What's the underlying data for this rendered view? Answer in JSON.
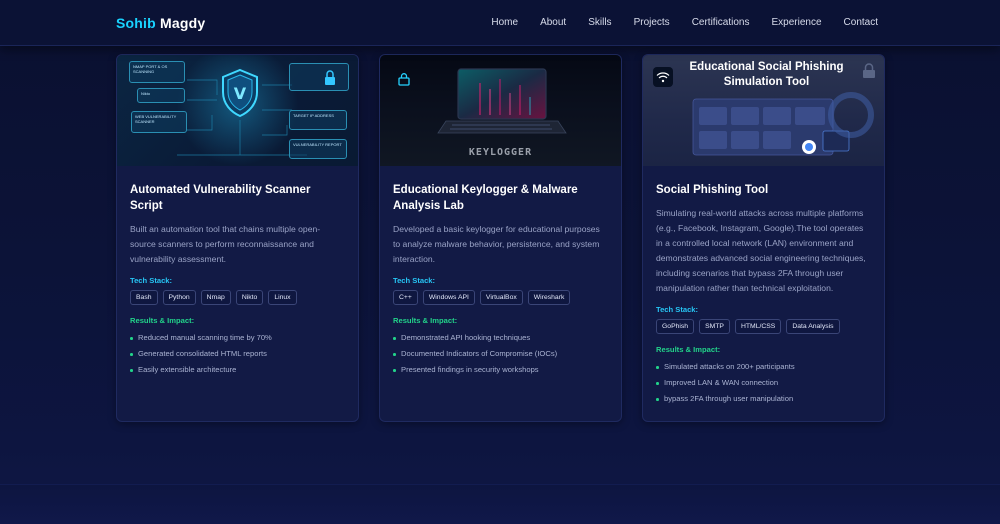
{
  "brand": {
    "first": "Sohib",
    "last": "Magdy"
  },
  "nav": [
    "Home",
    "About",
    "Skills",
    "Projects",
    "Certifications",
    "Experience",
    "Contact"
  ],
  "tech_stack_label": "Tech Stack:",
  "results_label": "Results & Impact:",
  "projects": [
    {
      "title": "Automated Vulnerability Scanner Script",
      "description": "Built an automation tool that chains multiple open-source scanners to perform reconnaissance and vulnerability assessment.",
      "tech": [
        "Bash",
        "Python",
        "Nmap",
        "Nikto",
        "Linux"
      ],
      "impact": [
        "Reduced manual scanning time by 70%",
        "Generated consolidated HTML reports",
        "Easily extensible architecture"
      ],
      "image": {
        "panels": [
          "NMAP PORT & OS SCANNING",
          "Nikto",
          "WEB VULNERABILITY SCANNER",
          "TARGET IP ADDRESS",
          "VULNERABILITY REPORT"
        ],
        "shield_letter": "V"
      }
    },
    {
      "title": "Educational Keylogger & Malware Analysis Lab",
      "description": "Developed a basic keylogger for educational purposes to analyze malware behavior, persistence, and system interaction.",
      "tech": [
        "C++",
        "Windows API",
        "VirtualBox",
        "Wireshark"
      ],
      "impact": [
        "Demonstrated API hooking techniques",
        "Documented Indicators of Compromise (IOCs)",
        "Presented findings in security workshops"
      ],
      "image": {
        "caption": "KEYLOGGER"
      }
    },
    {
      "title": "Social Phishing Tool",
      "description": "Simulating real-world attacks across multiple platforms (e.g., Facebook, Instagram, Google).The tool operates in a controlled local network (LAN) environment and demonstrates advanced social engineering techniques, including scenarios that bypass 2FA through user manipulation rather than technical exploitation.",
      "tech": [
        "GoPhish",
        "SMTP",
        "HTML/CSS",
        "Data Analysis"
      ],
      "impact": [
        "Simulated attacks on 200+ participants",
        "Improved LAN & WAN connection",
        "bypass 2FA through user manipulation"
      ],
      "image": {
        "title": "Educational Social Phishing Simulation Tool"
      }
    }
  ],
  "colors": {
    "accent": "#19d3ff",
    "tech_label": "#27c6f5",
    "results_label": "#22d38a",
    "background": "#0b1133",
    "card": "#121a45"
  }
}
